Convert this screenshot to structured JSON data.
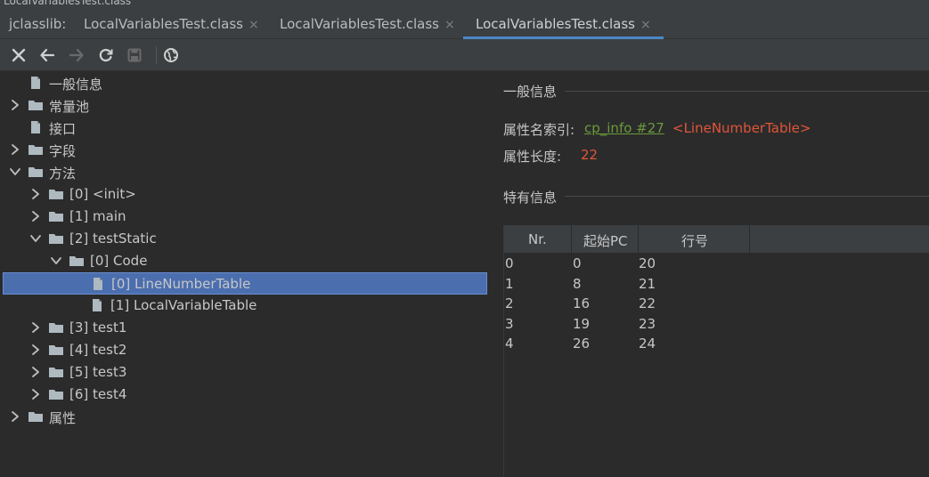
{
  "window": {
    "title_fragment": "LocalVariablesTest.class"
  },
  "tabbar": {
    "prefix": "jclasslib:",
    "tabs": [
      {
        "label": "LocalVariablesTest.class",
        "active": false,
        "closable": true
      },
      {
        "label": "LocalVariablesTest.class",
        "active": false,
        "closable": true
      },
      {
        "label": "LocalVariablesTest.class",
        "active": true,
        "closable": true
      }
    ],
    "close_glyph": "×"
  },
  "toolbar": {
    "icons": [
      "close-icon",
      "back-icon",
      "forward-icon",
      "reload-icon",
      "save-icon",
      "web-icon"
    ]
  },
  "tree": {
    "nodes": [
      {
        "label": "一般信息",
        "indent": 0,
        "type": "file",
        "expand": "none"
      },
      {
        "label": "常量池",
        "indent": 0,
        "type": "folder",
        "expand": "collapsed"
      },
      {
        "label": "接口",
        "indent": 0,
        "type": "file",
        "expand": "none"
      },
      {
        "label": "字段",
        "indent": 0,
        "type": "folder",
        "expand": "collapsed"
      },
      {
        "label": "方法",
        "indent": 0,
        "type": "folder",
        "expand": "expanded"
      },
      {
        "label": "[0] <init>",
        "indent": 1,
        "type": "folder",
        "expand": "collapsed"
      },
      {
        "label": "[1] main",
        "indent": 1,
        "type": "folder",
        "expand": "collapsed"
      },
      {
        "label": "[2] testStatic",
        "indent": 1,
        "type": "folder",
        "expand": "expanded"
      },
      {
        "label": "[0] Code",
        "indent": 2,
        "type": "folder",
        "expand": "expanded"
      },
      {
        "label": "[0] LineNumberTable",
        "indent": 3,
        "type": "file",
        "expand": "none",
        "selected": true
      },
      {
        "label": "[1] LocalVariableTable",
        "indent": 3,
        "type": "file",
        "expand": "none"
      },
      {
        "label": "[3] test1",
        "indent": 1,
        "type": "folder",
        "expand": "collapsed"
      },
      {
        "label": "[4] test2",
        "indent": 1,
        "type": "folder",
        "expand": "collapsed"
      },
      {
        "label": "[5] test3",
        "indent": 1,
        "type": "folder",
        "expand": "collapsed"
      },
      {
        "label": "[6] test4",
        "indent": 1,
        "type": "folder",
        "expand": "collapsed"
      },
      {
        "label": "属性",
        "indent": 0,
        "type": "folder",
        "expand": "collapsed"
      }
    ]
  },
  "detail": {
    "general_title": "一般信息",
    "name_index_label": "属性名索引:",
    "name_index_link": "cp_info #27",
    "name_index_value": "<LineNumberTable>",
    "length_label": "属性长度:",
    "length_value": "22",
    "specific_title": "特有信息",
    "table": {
      "headers": [
        "Nr.",
        "起始PC",
        "行号"
      ],
      "rows": [
        [
          "0",
          "0",
          "20"
        ],
        [
          "1",
          "8",
          "21"
        ],
        [
          "2",
          "16",
          "22"
        ],
        [
          "3",
          "19",
          "23"
        ],
        [
          "4",
          "26",
          "24"
        ]
      ]
    }
  },
  "colors": {
    "accent": "#4a88c7",
    "selection": "#4b6eaf",
    "link": "#6a9a3b",
    "value": "#e0553a"
  }
}
